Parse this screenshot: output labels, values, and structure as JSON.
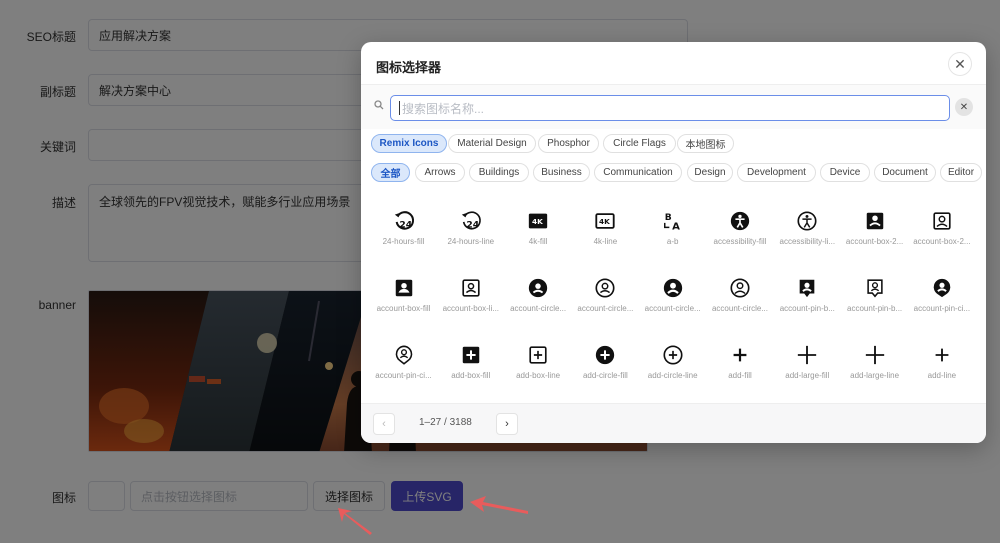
{
  "form": {
    "seo_title_label": "SEO标题",
    "seo_title_value": "应用解决方案",
    "subtitle_label": "副标题",
    "subtitle_value": "解决方案中心",
    "keywords_label": "关键词",
    "keywords_value": "",
    "description_label": "描述",
    "description_value": "全球领先的FPV视觉技术，赋能多行业应用场景",
    "banner_label": "banner",
    "icon_label": "图标",
    "icon_input_placeholder": "点击按钮选择图标",
    "select_icon_button": "选择图标",
    "upload_svg_button": "上传SVG"
  },
  "modal": {
    "title": "图标选择器",
    "search_placeholder": "搜索图标名称...",
    "sources": [
      {
        "label": "Remix Icons",
        "active": true
      },
      {
        "label": "Material Design",
        "active": false
      },
      {
        "label": "Phosphor",
        "active": false
      },
      {
        "label": "Circle Flags",
        "active": false
      },
      {
        "label": "本地图标",
        "active": false
      }
    ],
    "categories": [
      {
        "label": "全部",
        "active": true
      },
      {
        "label": "Arrows",
        "active": false
      },
      {
        "label": "Buildings",
        "active": false
      },
      {
        "label": "Business",
        "active": false
      },
      {
        "label": "Communication",
        "active": false
      },
      {
        "label": "Design",
        "active": false
      },
      {
        "label": "Development",
        "active": false
      },
      {
        "label": "Device",
        "active": false
      },
      {
        "label": "Document",
        "active": false
      },
      {
        "label": "Editor",
        "active": false
      }
    ],
    "icons": [
      {
        "name": "24-hours-fill",
        "glyph": "24h-fill"
      },
      {
        "name": "24-hours-line",
        "glyph": "24h-line"
      },
      {
        "name": "4k-fill",
        "glyph": "4k-fill"
      },
      {
        "name": "4k-line",
        "glyph": "4k-line"
      },
      {
        "name": "a-b",
        "glyph": "a-b"
      },
      {
        "name": "accessibility-fill",
        "glyph": "access-fill"
      },
      {
        "name": "accessibility-li...",
        "glyph": "access-line"
      },
      {
        "name": "account-box-2...",
        "glyph": "abox2-fill"
      },
      {
        "name": "account-box-2...",
        "glyph": "abox2-line"
      },
      {
        "name": "account-box-fill",
        "glyph": "abox-fill"
      },
      {
        "name": "account-box-li...",
        "glyph": "abox-line"
      },
      {
        "name": "account-circle...",
        "glyph": "acirc2-fill"
      },
      {
        "name": "account-circle...",
        "glyph": "acirc2-line"
      },
      {
        "name": "account-circle...",
        "glyph": "acirc-fill"
      },
      {
        "name": "account-circle...",
        "glyph": "acirc-line"
      },
      {
        "name": "account-pin-b...",
        "glyph": "apinb-fill"
      },
      {
        "name": "account-pin-b...",
        "glyph": "apinb-line"
      },
      {
        "name": "account-pin-ci...",
        "glyph": "apinc-fill"
      },
      {
        "name": "account-pin-ci...",
        "glyph": "apinc-line"
      },
      {
        "name": "add-box-fill",
        "glyph": "addbox-fill"
      },
      {
        "name": "add-box-line",
        "glyph": "addbox-line"
      },
      {
        "name": "add-circle-fill",
        "glyph": "addcirc-fill"
      },
      {
        "name": "add-circle-line",
        "glyph": "addcirc-line"
      },
      {
        "name": "add-fill",
        "glyph": "add-fill"
      },
      {
        "name": "add-large-fill",
        "glyph": "addlarge"
      },
      {
        "name": "add-large-line",
        "glyph": "addlarge"
      },
      {
        "name": "add-line",
        "glyph": "add-line"
      }
    ],
    "pagination": "1–27 / 3188",
    "prev_symbol": "‹",
    "next_symbol": "›",
    "close_symbol": "✕",
    "clear_symbol": "✕",
    "search_icon_symbol": "⚲"
  },
  "colors": {
    "primary": "#4f4bcf",
    "active_pill_bg": "#dbe8fb",
    "active_pill_text": "#1d57c4",
    "arrow": "#e85c5c"
  }
}
